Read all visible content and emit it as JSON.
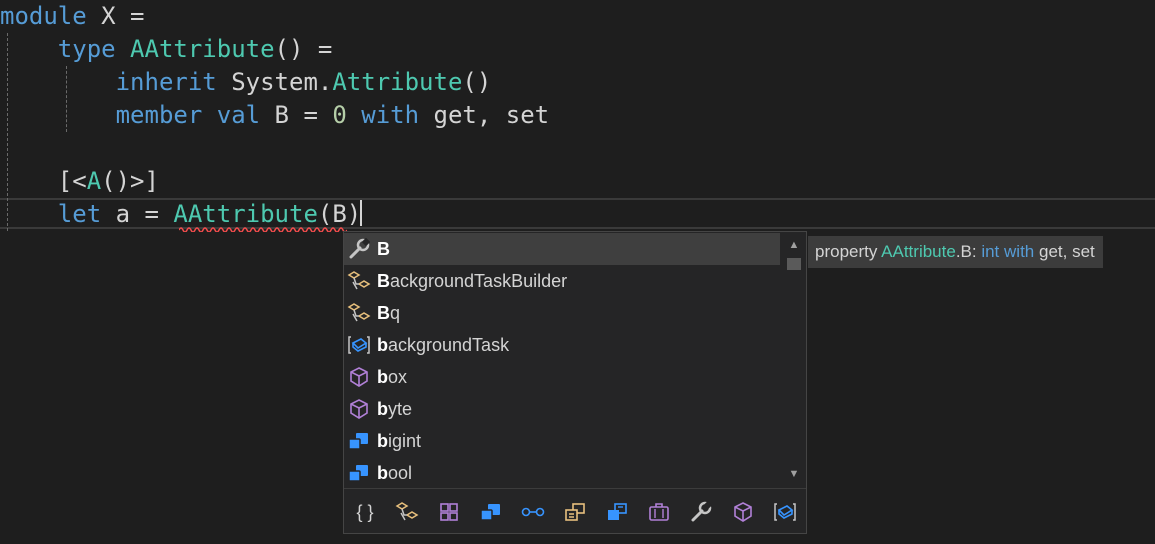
{
  "editor": {
    "lines": [
      {
        "tokens": [
          {
            "t": "module",
            "c": "kw"
          },
          {
            "t": " X =",
            "c": "tx"
          }
        ]
      },
      {
        "tokens": [
          {
            "t": "    ",
            "c": "tx"
          },
          {
            "t": "type",
            "c": "kw"
          },
          {
            "t": " ",
            "c": "tx"
          },
          {
            "t": "AAttribute",
            "c": "ty"
          },
          {
            "t": "() =",
            "c": "tx"
          }
        ]
      },
      {
        "tokens": [
          {
            "t": "        ",
            "c": "tx"
          },
          {
            "t": "inherit",
            "c": "kw"
          },
          {
            "t": " System.",
            "c": "tx"
          },
          {
            "t": "Attribute",
            "c": "ty"
          },
          {
            "t": "()",
            "c": "tx"
          }
        ]
      },
      {
        "tokens": [
          {
            "t": "        ",
            "c": "tx"
          },
          {
            "t": "member",
            "c": "kw"
          },
          {
            "t": " ",
            "c": "tx"
          },
          {
            "t": "val",
            "c": "kw"
          },
          {
            "t": " B = ",
            "c": "tx"
          },
          {
            "t": "0",
            "c": "num"
          },
          {
            "t": " ",
            "c": "tx"
          },
          {
            "t": "with",
            "c": "kw"
          },
          {
            "t": " get, set",
            "c": "tx"
          }
        ]
      },
      {
        "tokens": []
      },
      {
        "tokens": [
          {
            "t": "    [<",
            "c": "tx"
          },
          {
            "t": "A",
            "c": "ty"
          },
          {
            "t": "()>]",
            "c": "tx"
          }
        ]
      },
      {
        "tokens": [
          {
            "t": "    ",
            "c": "tx"
          },
          {
            "t": "let",
            "c": "kw"
          },
          {
            "t": " a = ",
            "c": "tx"
          },
          {
            "t": "AAttribute",
            "c": "ty"
          },
          {
            "t": "(B)",
            "c": "tx"
          }
        ]
      }
    ]
  },
  "completion": {
    "typed": "B",
    "items": [
      {
        "label": "B",
        "match": "B",
        "rest": "",
        "icon": "wrench-property-icon",
        "selected": true
      },
      {
        "label": "BackgroundTaskBuilder",
        "match": "B",
        "rest": "ackgroundTaskBuilder",
        "icon": "extension-method-icon",
        "selected": false
      },
      {
        "label": "Bq",
        "match": "B",
        "rest": "q",
        "icon": "extension-method-icon",
        "selected": false
      },
      {
        "label": "backgroundTask",
        "match": "b",
        "rest": "ackgroundTask",
        "icon": "field-bracket-icon",
        "selected": false
      },
      {
        "label": "box",
        "match": "b",
        "rest": "ox",
        "icon": "method-cube-icon",
        "selected": false
      },
      {
        "label": "byte",
        "match": "b",
        "rest": "yte",
        "icon": "method-cube-icon",
        "selected": false
      },
      {
        "label": "bigint",
        "match": "b",
        "rest": "igint",
        "icon": "class-blocks-icon",
        "selected": false
      },
      {
        "label": "bool",
        "match": "b",
        "rest": "ool",
        "icon": "class-blocks-icon",
        "selected": false
      }
    ],
    "filters": [
      {
        "name": "namespace-braces-icon",
        "glyph": "{ }"
      },
      {
        "name": "extension-method-filter-icon"
      },
      {
        "name": "module-grid-filter-icon"
      },
      {
        "name": "class-filter-icon"
      },
      {
        "name": "interface-filter-icon"
      },
      {
        "name": "enum-filter-icon"
      },
      {
        "name": "struct-filter-icon"
      },
      {
        "name": "delegate-briefcase-filter-icon"
      },
      {
        "name": "property-wrench-filter-icon"
      },
      {
        "name": "method-cube-filter-icon"
      },
      {
        "name": "field-filter-icon"
      }
    ]
  },
  "tooltip": {
    "tokens": [
      {
        "t": "property ",
        "c": "tx"
      },
      {
        "t": "AAttribute",
        "c": "ty"
      },
      {
        "t": ".B: ",
        "c": "tx"
      },
      {
        "t": "int",
        "c": "kw"
      },
      {
        "t": " ",
        "c": "tx"
      },
      {
        "t": "with",
        "c": "kw"
      },
      {
        "t": " get, set",
        "c": "tx"
      }
    ]
  },
  "colors": {
    "background": "#1e1e1e",
    "keyword": "#569cd6",
    "type": "#4ec9b0",
    "number": "#b5cea8",
    "text": "#d4d4d4"
  }
}
